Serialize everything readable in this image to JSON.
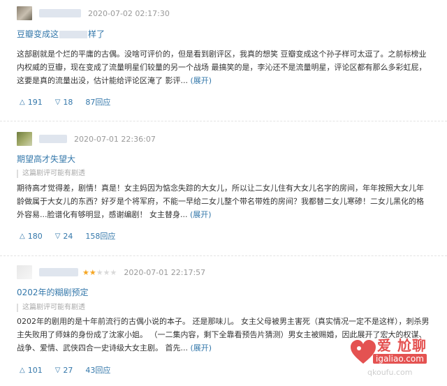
{
  "reviews": [
    {
      "time": "2020-07-02 02:17:30",
      "stars": 0,
      "title_prefix": "豆瓣变成这",
      "title_suffix": "样了",
      "spoiler": "",
      "body": "这部剧就是个烂的平庸的古偶。没啥可评价的，但是看到剧评区，我真的想笑 豆瓣变成这个孙子样可太逗了。之前标榜业内权威的豆瓣，现在变成了流量明星们较量的另一个战场 最搞笑的是，李沁还不是流量明星，评论区都有那么多彩虹屁，这要是真的流量出没，估计能给评论区淹了 影评...",
      "expand": "(展开)",
      "up": "191",
      "down": "18",
      "reply": "87回应"
    },
    {
      "time": "2020-07-01 22:36:07",
      "stars": 0,
      "title_prefix": "期望高才失望大",
      "title_suffix": "",
      "spoiler": "这篇剧评可能有剧透",
      "body": "期待高才觉得差，剧情！真是！女主妈因为惦念失踪的大女儿，所以让二女儿住有大女儿名字的房间，年年按照大女儿年龄做属于大女儿的东西？好歹是个将军府，不能一早给二女儿整个带名带姓的房间？我都替二女儿寒碜！二女儿黑化的格外容易...脸谱化有够明显，感谢编剧！ 女主替身...",
      "expand": "(展开)",
      "up": "180",
      "down": "24",
      "reply": "158回应"
    },
    {
      "time": "2020-07-01 22:17:57",
      "stars": 2,
      "title_prefix": "0202年的糊剧预定",
      "title_suffix": "",
      "spoiler": "这篇剧评可能有剧透",
      "body": "0202年的剧用的是十年前流行的古偶小说的本子。 还是那味儿。 女主父母被男主害死（真实情况一定不是这样），刺杀男主失败用了师妹的身份成了沈家小姐。 （一二集内容，剩下全靠看预告片猜测）男女主被赐婚，因此展开了宏大的权谋、战争、爱情、武侠四合一史诗级大女主剧。 首先...",
      "expand": "(展开)",
      "up": "101",
      "down": "27",
      "reply": "43回应"
    }
  ],
  "watermark": {
    "line1": "爱 尬聊",
    "line2": "igaliao.com",
    "line3": "qkoufu.com"
  },
  "colors": {
    "link": "#3377aa",
    "star": "#f5a623",
    "brand_red": "#e2403f"
  }
}
